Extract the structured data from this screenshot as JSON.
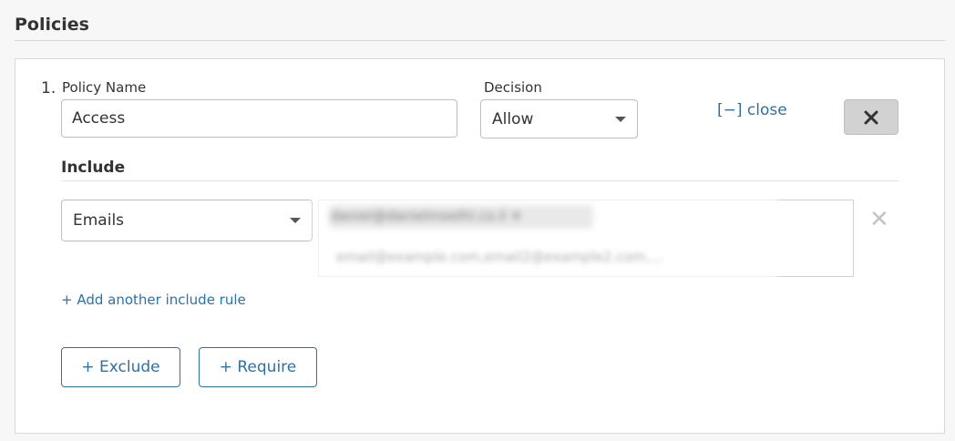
{
  "section": {
    "title": "Policies"
  },
  "policy": {
    "number": "1.",
    "name_label": "Policy Name",
    "name_value": "Access",
    "decision_label": "Decision",
    "decision_value": "Allow",
    "close_link": "[−] close",
    "remove_icon": "close-x-icon"
  },
  "include": {
    "title": "Include",
    "selector_value": "Emails",
    "email_chip": "daniel@danielmoelhl.co.il",
    "email_chip_icon": "remove-x-icon",
    "email_placeholder": "email@example.com,email2@example2.com,...",
    "row_remove_icon": "remove-x-icon",
    "add_rule": "+ Add another include rule"
  },
  "actions": {
    "exclude": "+ Exclude",
    "require": "+ Require"
  },
  "colors": {
    "link": "#2b72a8",
    "remove_button_bg": "#d2d2d2",
    "border": "#bfbfbf"
  }
}
